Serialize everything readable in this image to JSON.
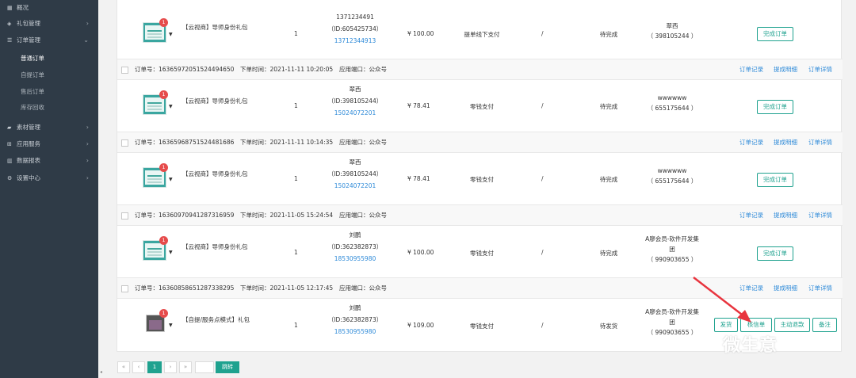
{
  "sidebar": {
    "items": [
      {
        "label": "概况",
        "icon": "grid-icon"
      },
      {
        "label": "礼包管理",
        "icon": "gift-icon",
        "arrow": "›"
      },
      {
        "label": "订单管理",
        "icon": "list-icon",
        "arrow": "⌄",
        "children": [
          {
            "label": "普通订单",
            "active": true
          },
          {
            "label": "自提订单"
          },
          {
            "label": "售后订单"
          },
          {
            "label": "库存回收"
          }
        ]
      },
      {
        "label": "素材管理",
        "icon": "folder-icon",
        "arrow": "›"
      },
      {
        "label": "应用服务",
        "icon": "apps-icon",
        "arrow": "›"
      },
      {
        "label": "数据报表",
        "icon": "chart-icon",
        "arrow": "›"
      },
      {
        "label": "设置中心",
        "icon": "gear-icon",
        "arrow": "›"
      }
    ]
  },
  "orders": [
    {
      "product": "【云视商】导师身份礼包",
      "badge": "1",
      "qty": "1",
      "buyer": {
        "line1": "1371234491",
        "line2": "（ID:605425734）",
        "phone": "13712344913"
      },
      "price": "¥ 100.00",
      "pay_type": "提单线下支付",
      "slash": "/",
      "status": "待完成",
      "shop": {
        "line1": "翠西",
        "line2": "（ 398105244 ）",
        "line3": ""
      },
      "buttons": [
        "完成订单"
      ]
    },
    {
      "header": {
        "order_no": "订单号：16365972051524494650",
        "time": "下单时间：2021-11-11 10:20:05",
        "channel": "应用端口：公众号"
      },
      "links": [
        "订单记录",
        "提成明细",
        "订单详情"
      ],
      "product": "【云视商】导师身份礼包",
      "badge": "1",
      "qty": "1",
      "buyer": {
        "line1": "翠西",
        "line2": "（ID:398105244）",
        "phone": "15024072201"
      },
      "price": "¥ 78.41",
      "pay_type": "零钱支付",
      "slash": "/",
      "status": "待完成",
      "shop": {
        "line1": "wwwwww",
        "line2": "（ 655175644 ）",
        "line3": ""
      },
      "buttons": [
        "完成订单"
      ]
    },
    {
      "header": {
        "order_no": "订单号：16365968751524481686",
        "time": "下单时间：2021-11-11 10:14:35",
        "channel": "应用端口：公众号"
      },
      "links": [
        "订单记录",
        "提成明细",
        "订单详情"
      ],
      "product": "【云视商】导师身份礼包",
      "badge": "1",
      "qty": "1",
      "buyer": {
        "line1": "翠西",
        "line2": "（ID:398105244）",
        "phone": "15024072201"
      },
      "price": "¥ 78.41",
      "pay_type": "零钱支付",
      "slash": "/",
      "status": "待完成",
      "shop": {
        "line1": "wwwwww",
        "line2": "（ 655175644 ）",
        "line3": ""
      },
      "buttons": [
        "完成订单"
      ]
    },
    {
      "header": {
        "order_no": "订单号：16360970941287316959",
        "time": "下单时间：2021-11-05 15:24:54",
        "channel": "应用端口：公众号"
      },
      "links": [
        "订单记录",
        "提成明细",
        "订单详情"
      ],
      "product": "【云视商】导师身份礼包",
      "badge": "1",
      "qty": "1",
      "buyer": {
        "line1": "刘鹏",
        "line2": "（ID:362382873）",
        "phone": "18530955980"
      },
      "price": "¥ 100.00",
      "pay_type": "零钱支付",
      "slash": "/",
      "status": "待完成",
      "shop": {
        "line1": "A廖会员-软件开发集",
        "line2": "团",
        "line3": "（ 990903655 ）"
      },
      "buttons": [
        "完成订单"
      ]
    },
    {
      "header": {
        "order_no": "订单号：16360858651287338295",
        "time": "下单时间：2021-11-05 12:17:45",
        "channel": "应用端口：公众号"
      },
      "links": [
        "订单记录",
        "提成明细",
        "订单详情"
      ],
      "product": "【自提/服务点模式】礼包",
      "badge": "1",
      "qty": "1",
      "buyer": {
        "line1": "刘鹏",
        "line2": "（ID:362382873）",
        "phone": "18530955980"
      },
      "price": "¥ 109.00",
      "pay_type": "零钱支付",
      "slash": "/",
      "status": "待发货",
      "shop": {
        "line1": "A廖会员-软件开发集",
        "line2": "团",
        "line3": "（ 990903655 ）"
      },
      "buttons": [
        "发货",
        "核信单",
        "主动退款",
        "备注"
      ]
    }
  ],
  "pagination": {
    "first": "«",
    "prev": "‹",
    "current": "1",
    "next": "›",
    "last": "»",
    "goto_label": "跳转"
  },
  "watermark": "微生意",
  "colors": {
    "sidebar_bg": "#2f3b47",
    "accent": "#1fa28f",
    "link": "#2e8ad8",
    "badge": "#e64c4c",
    "arrow": "#e8343e"
  }
}
